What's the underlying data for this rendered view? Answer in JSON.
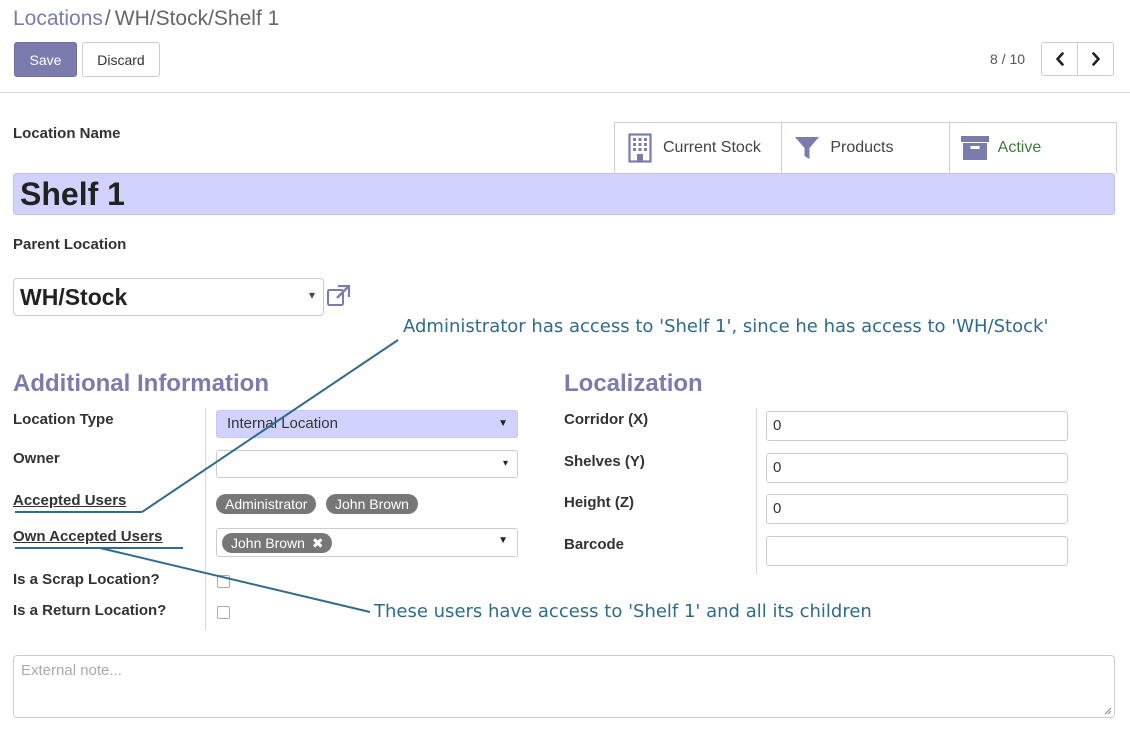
{
  "breadcrumb": {
    "parent": "Locations",
    "separator": "/",
    "current": "WH/Stock/Shelf 1"
  },
  "toolbar": {
    "save_label": "Save",
    "discard_label": "Discard"
  },
  "pager": {
    "value": "8 / 10",
    "prev_icon": "chevron-left-icon",
    "next_icon": "chevron-right-icon"
  },
  "button_box": {
    "current_stock": {
      "label": "Current Stock",
      "icon": "building-icon"
    },
    "products": {
      "label": "Products",
      "icon": "filter-icon"
    },
    "active": {
      "label": "Active",
      "icon": "archive-icon",
      "color": "#3e7a3e"
    }
  },
  "location": {
    "name_label": "Location Name",
    "name": "Shelf 1",
    "parent_label": "Parent Location",
    "parent": "WH/Stock"
  },
  "additional_info": {
    "title": "Additional Information",
    "location_type_label": "Location Type",
    "location_type": "Internal Location",
    "owner_label": "Owner",
    "owner": "",
    "accepted_users_label": "Accepted Users",
    "accepted_users": [
      "Administrator",
      "John Brown"
    ],
    "own_accepted_users_label": "Own Accepted Users",
    "own_accepted_users": [
      "John Brown"
    ],
    "scrap_label": "Is a Scrap Location?",
    "scrap": false,
    "return_label": "Is a Return Location?",
    "return": false
  },
  "localization": {
    "title": "Localization",
    "corridor_label": "Corridor (X)",
    "corridor": "0",
    "shelves_label": "Shelves (Y)",
    "shelves": "0",
    "height_label": "Height (Z)",
    "height": "0",
    "barcode_label": "Barcode",
    "barcode": ""
  },
  "note": {
    "placeholder": "External note..."
  },
  "annotations": {
    "top": "Administrator has access to 'Shelf 1', since he has access to 'WH/Stock'",
    "bottom": "These users have access to 'Shelf 1' and all its children"
  },
  "colors": {
    "brand": "#7c7bad",
    "highlight": "#d2d2ff",
    "annotation": "#2e6b8c"
  }
}
